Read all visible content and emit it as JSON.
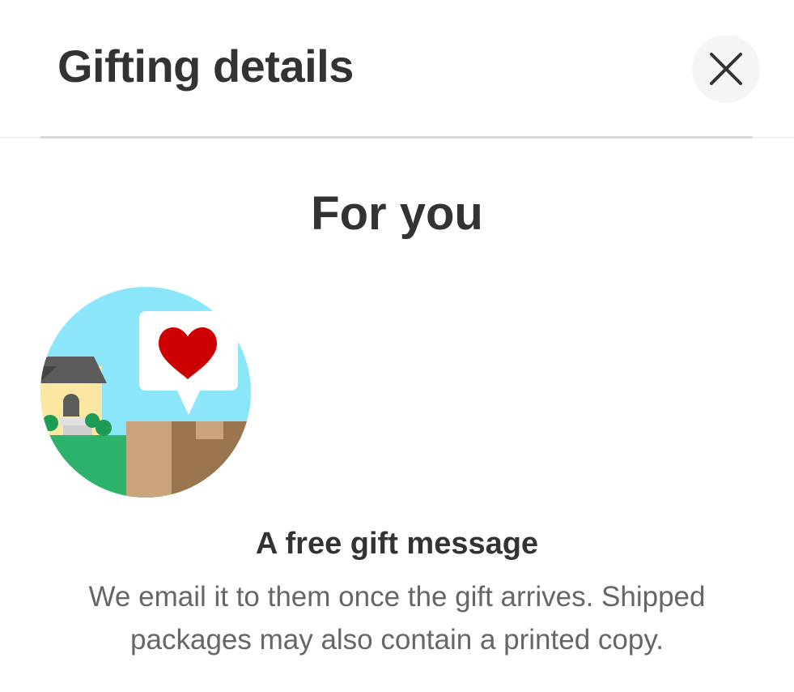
{
  "header": {
    "title": "Gifting details",
    "close_icon": "close-icon"
  },
  "section": {
    "title": "For you"
  },
  "illustration": {
    "icon": "gift-delivery-illustration",
    "colors": {
      "sky": "#8ce6fa",
      "grass": "#2db36b",
      "house_wall": "#fbe6a2",
      "roof": "#5c5c5c",
      "bubble": "#ffffff",
      "heart": "#cc0000",
      "box_light": "#c9a47c",
      "box_dark": "#9b7550"
    }
  },
  "feature": {
    "title": "A free gift message",
    "description": "We email it to them once the gift arrives. Shipped packages may also contain a printed copy."
  },
  "colors": {
    "text_primary": "#333333",
    "text_secondary": "#666666",
    "divider": "#d9d9d9",
    "close_button_bg": "#f5f5f5"
  }
}
